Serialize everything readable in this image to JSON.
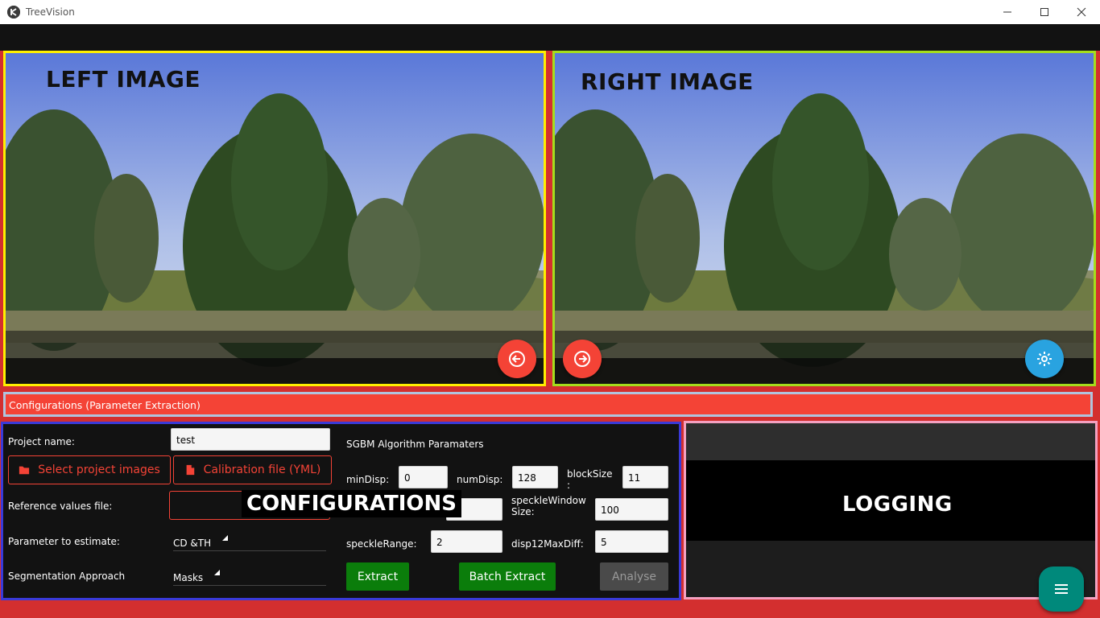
{
  "window": {
    "title": "TreeVision",
    "controls": [
      "minimize-icon",
      "maximize-icon",
      "close-icon"
    ]
  },
  "left_image": {
    "label": "LEFT IMAGE",
    "border_color": "#ffef00",
    "button_icon": "arrow-left-circle-icon"
  },
  "right_image": {
    "label": "RIGHT IMAGE",
    "border_color": "#a5dd1c",
    "nav_button_icon": "arrow-right-circle-icon",
    "settings_button_icon": "gear-icon"
  },
  "config_header": {
    "title": "Configurations (Parameter Extraction)"
  },
  "config": {
    "overlay_label": "CONFIGURATIONS",
    "project_name_label": "Project name:",
    "project_name_value": "test",
    "select_images_button": "Select project images",
    "calibration_button": "Calibration file (YML)",
    "reference_label": "Reference values file:",
    "parameter_label": "Parameter to estimate:",
    "parameter_value": "CD &TH",
    "segmentation_label": "Segmentation Approach",
    "segmentation_value": "Masks",
    "sgbm_title": "SGBM Algorithm Paramaters",
    "min_disp_label": "minDisp:",
    "min_disp_value": "0",
    "num_disp_label": "numDisp:",
    "num_disp_value": "128",
    "block_size_label_1": "blockSize",
    "block_size_label_2": ":",
    "block_size_value": "11",
    "speckle_window_label_1": "speckleWindow",
    "speckle_window_label_2": "Size:",
    "speckle_window_value": "100",
    "speckle_range_label": "speckleRange:",
    "speckle_range_value": "2",
    "disp12_label": "disp12MaxDiff:",
    "disp12_value": "5",
    "extract_button": "Extract",
    "batch_extract_button": "Batch Extract",
    "analyse_button": "Analyse"
  },
  "logging": {
    "label": "LOGGING",
    "menu_icon": "menu-icon"
  },
  "colors": {
    "accent_red": "#f44336",
    "background_red": "#d32f2f",
    "green_button": "#0b7d0b",
    "settings_blue": "#29a3e0",
    "menu_teal": "#00897b"
  }
}
